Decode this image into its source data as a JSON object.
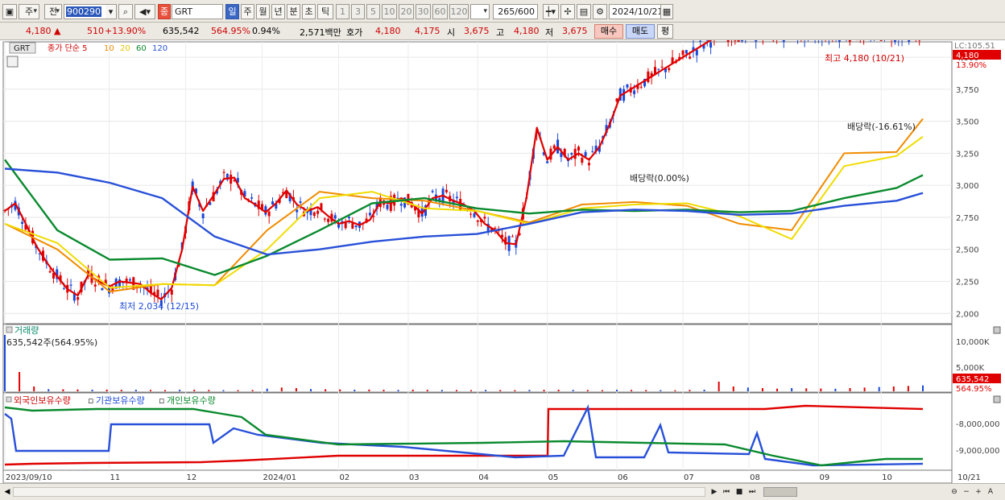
{
  "toolbar": {
    "period_week": "주",
    "prefix": "전",
    "code": "900290",
    "stock_tag": "종",
    "stock_name": "GRT",
    "periods": [
      "일",
      "주",
      "월",
      "년",
      "분",
      "초",
      "틱"
    ],
    "intervals": [
      "1",
      "3",
      "5",
      "10",
      "20",
      "30",
      "60",
      "120"
    ],
    "count": "265",
    "count_total": "/600",
    "date": "2024/10/21"
  },
  "quote": {
    "price": "4,180",
    "change": "510",
    "change_pct": "+13.90%",
    "volume": "635,542",
    "volume_ratio": "564.95%",
    "turnover": "0.94%",
    "amount": "2,571백만",
    "hoga_label": "호가",
    "ask": "4,180",
    "bid": "4,175",
    "open_label": "시",
    "open": "3,675",
    "high_label": "고",
    "high": "4,180",
    "low_label": "저",
    "low": "3,675",
    "buy": "매수",
    "sell": "매도",
    "avg": "평"
  },
  "colors": {
    "ma5": "#e00000",
    "ma10": "#f08c00",
    "ma20": "#f0dc00",
    "ma60": "#0a8a2e",
    "ma120": "#2850d8",
    "up": "#e00000",
    "down": "#1a48d8"
  },
  "chart_data": [
    {
      "type": "line",
      "title": "GRT",
      "legend": [
        "종가 단순 5",
        "10",
        "20",
        "60",
        "120"
      ],
      "x_ticks": [
        "2023/09/10",
        "11",
        "12",
        "2024/01",
        "02",
        "03",
        "04",
        "05",
        "06",
        "07",
        "08",
        "09",
        "10",
        "10/21"
      ],
      "y_ticks": [
        2000,
        2250,
        2500,
        2750,
        3000,
        3250,
        3500,
        3750,
        4000
      ],
      "ylim": [
        1920,
        4120
      ],
      "annotations": {
        "high": "최고 4,180 (10/21)",
        "low": "최저 2,034 (12/15)",
        "div1": "배당락(0.00%)",
        "div2": "배당락(-16.61%)",
        "axis_top": "LC:105.51",
        "last_price": "4,180",
        "last_pct": "13.90%"
      },
      "series": [
        {
          "name": "5",
          "x": [
            0,
            3,
            6,
            9,
            12,
            15,
            18,
            21,
            24,
            27,
            30,
            33,
            36,
            39,
            42,
            45,
            48,
            51,
            54,
            57,
            60,
            63,
            66,
            69,
            72,
            75,
            78,
            81,
            84,
            87,
            90,
            93,
            96,
            99,
            102,
            105,
            108,
            111,
            114,
            117,
            120,
            123,
            126,
            129,
            132,
            135,
            138,
            141,
            144,
            147,
            150,
            153,
            156,
            159,
            162,
            165,
            168,
            171,
            174,
            177,
            180,
            183,
            186,
            189,
            192,
            195,
            198,
            201,
            204,
            207,
            210,
            213,
            216,
            219,
            222,
            225,
            228,
            231,
            234,
            237,
            240,
            243,
            246,
            249,
            252,
            255,
            258,
            261,
            264
          ],
          "y": [
            2800,
            2860,
            2700,
            2530,
            2400,
            2290,
            2190,
            2140,
            2300,
            2250,
            2210,
            2250,
            2240,
            2230,
            2160,
            2110,
            2200,
            2500,
            2990,
            2800,
            2920,
            3050,
            3060,
            2900,
            2850,
            2790,
            2860,
            2960,
            2850,
            2800,
            2830,
            2760,
            2700,
            2720,
            2690,
            2730,
            2870,
            2860,
            2900,
            2860,
            2780,
            2900,
            2920,
            2880,
            2850,
            2800,
            2700,
            2650,
            2550,
            2540,
            2900,
            3450,
            3200,
            3300,
            3200,
            3250,
            3200,
            3300,
            3480,
            3700,
            3750,
            3800,
            3850,
            3900,
            3950,
            4000,
            4050,
            4100,
            4150,
            4180,
            4180,
            4180,
            4180,
            4180,
            4180,
            4180,
            4180,
            4180,
            4180,
            4180,
            4180,
            4180,
            4180,
            4180,
            4180,
            4180,
            4180,
            4180,
            4180
          ]
        },
        {
          "name": "10",
          "x": [
            0,
            10,
            20,
            30,
            40,
            50,
            60,
            70,
            80,
            90,
            100,
            110,
            120,
            130,
            140,
            150,
            160,
            170,
            175
          ],
          "y": [
            2700,
            2500,
            2170,
            2230,
            2220,
            2650,
            2950,
            2900,
            2880,
            2800,
            2710,
            2850,
            2870,
            2840,
            2700,
            2650,
            3250,
            3260,
            3520
          ]
        },
        {
          "name": "20",
          "x": [
            0,
            10,
            20,
            30,
            40,
            50,
            60,
            70,
            80,
            90,
            100,
            110,
            120,
            130,
            140,
            150,
            160,
            170,
            175
          ],
          "y": [
            2700,
            2550,
            2200,
            2230,
            2220,
            2500,
            2900,
            2950,
            2820,
            2800,
            2700,
            2820,
            2850,
            2860,
            2760,
            2580,
            3150,
            3230,
            3380
          ]
        },
        {
          "name": "60",
          "x": [
            0,
            10,
            20,
            30,
            40,
            50,
            60,
            70,
            80,
            90,
            100,
            110,
            120,
            130,
            140,
            150,
            160,
            170,
            175
          ],
          "y": [
            3200,
            2650,
            2420,
            2430,
            2300,
            2450,
            2650,
            2860,
            2900,
            2820,
            2780,
            2810,
            2800,
            2810,
            2790,
            2800,
            2900,
            2980,
            3080
          ]
        },
        {
          "name": "120",
          "x": [
            0,
            10,
            20,
            30,
            40,
            50,
            60,
            70,
            80,
            90,
            100,
            110,
            120,
            130,
            140,
            150,
            160,
            170,
            175
          ],
          "y": [
            3130,
            3100,
            3020,
            2900,
            2600,
            2460,
            2500,
            2560,
            2600,
            2620,
            2700,
            2790,
            2810,
            2800,
            2770,
            2780,
            2840,
            2880,
            2940
          ]
        }
      ]
    },
    {
      "type": "bar",
      "title": "거래량",
      "label": "635,542주(564.95%)",
      "y_ticks": [
        "10,000K",
        "5,000K"
      ],
      "last_value": "635,542",
      "last_pct": "564.95%",
      "series": [
        {
          "name": "volume",
          "values": [
            10500,
            3600,
            900,
            400,
            380,
            350,
            300,
            320,
            280,
            300,
            260,
            240,
            300,
            280,
            250,
            220,
            210,
            240,
            500,
            700,
            600,
            420,
            380,
            350,
            300,
            320,
            280,
            260,
            300,
            280,
            260,
            240,
            220,
            260,
            240,
            220,
            260,
            280,
            300,
            260,
            240,
            220,
            300,
            260,
            240,
            220,
            200,
            260,
            300,
            1800,
            900,
            700,
            600,
            500,
            600,
            560,
            520,
            480,
            600,
            700,
            800,
            900,
            1000,
            1100
          ]
        }
      ]
    },
    {
      "type": "line",
      "title": "외국인보유수량 · 기관보유수량 · 개인보유수량",
      "legend": [
        "외국인보유수량",
        "기관보유수량",
        "개인보유수량"
      ],
      "y_ticks": [
        "-8,000,000",
        "-9,000,000"
      ]
    }
  ]
}
